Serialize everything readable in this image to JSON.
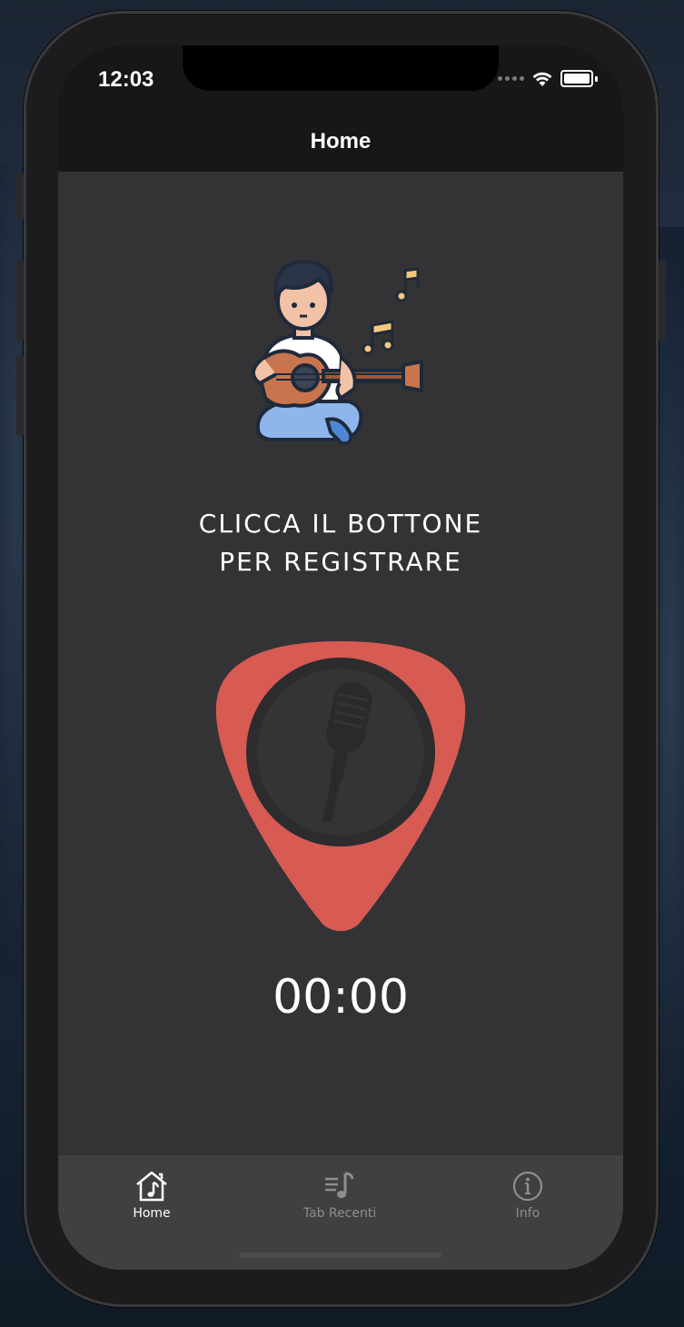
{
  "status_bar": {
    "time": "12:03"
  },
  "nav": {
    "title": "Home"
  },
  "main": {
    "prompt_line1": "CLICCA IL BOTTONE",
    "prompt_line2": "PER REGISTRARE",
    "timer": "00:00"
  },
  "tabs": [
    {
      "label": "Home",
      "icon": "home-music-icon",
      "selected": true
    },
    {
      "label": "Tab Recenti",
      "icon": "music-list-icon",
      "selected": false
    },
    {
      "label": "Info",
      "icon": "info-icon",
      "selected": false
    }
  ],
  "colors": {
    "accent": "#d75a53",
    "background": "#333335",
    "navbar": "#171718",
    "tabbar": "#404042"
  }
}
